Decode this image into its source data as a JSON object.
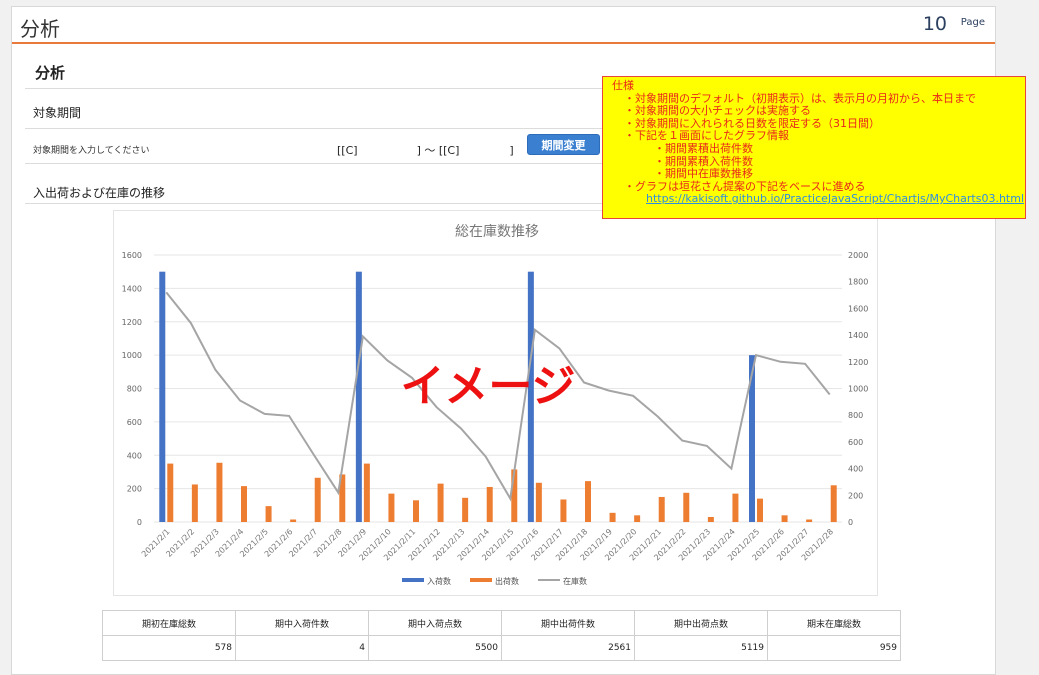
{
  "header": {
    "title": "分析",
    "page_number": "10",
    "page_label": "Page"
  },
  "section": {
    "title": "分析",
    "period_label": "対象期間",
    "period_hint": "対象期間を入力してください",
    "range_start": "[[C]",
    "range_sep": "] ～ [[C]",
    "range_end": "]",
    "change_button": "期間変更",
    "trend_label": "入出荷および在庫の推移"
  },
  "spec_note": {
    "heading": "仕様",
    "lines": [
      "・対象期間のデフォルト（初期表示）は、表示月の月初から、本日まで",
      "・対象期間の大小チェックは実施する",
      "・対象期間に入れられる日数を限定する（31日間）",
      "・下記を１画面にしたグラフ情報",
      "・期間累積出荷件数",
      "・期間累積入荷件数",
      "・期間中在庫数推移",
      "・グラフは垣花さん提案の下記をベースに進める"
    ],
    "link": "https://kakisoft.github.io/PracticeJavaScript/Chartjs/MyCharts03.html"
  },
  "chart_data": {
    "type": "bar",
    "title": "総在庫数推移",
    "overlay_text": "イメージ",
    "categories": [
      "2021/2/1",
      "2021/2/2",
      "2021/2/3",
      "2021/2/4",
      "2021/2/5",
      "2021/2/6",
      "2021/2/7",
      "2021/2/8",
      "2021/2/9",
      "2021/2/10",
      "2021/2/11",
      "2021/2/12",
      "2021/2/13",
      "2021/2/14",
      "2021/2/15",
      "2021/2/16",
      "2021/2/17",
      "2021/2/18",
      "2021/2/19",
      "2021/2/20",
      "2021/2/21",
      "2021/2/22",
      "2021/2/23",
      "2021/2/24",
      "2021/2/25",
      "2021/2/26",
      "2021/2/27",
      "2021/2/28"
    ],
    "series": [
      {
        "name": "入荷数",
        "type": "bar",
        "axis": "left",
        "color": "#4472c4",
        "values": [
          1500,
          0,
          0,
          0,
          0,
          0,
          0,
          0,
          1500,
          0,
          0,
          0,
          0,
          0,
          0,
          1500,
          0,
          0,
          0,
          0,
          0,
          0,
          0,
          0,
          1000,
          0,
          0,
          0
        ]
      },
      {
        "name": "出荷数",
        "type": "bar",
        "axis": "left",
        "color": "#ed7d31",
        "values": [
          350,
          225,
          355,
          215,
          95,
          15,
          265,
          285,
          350,
          170,
          130,
          230,
          145,
          210,
          315,
          235,
          135,
          245,
          55,
          40,
          150,
          175,
          30,
          170,
          140,
          40,
          15,
          220
        ]
      },
      {
        "name": "在庫数",
        "type": "line",
        "axis": "right",
        "color": "#a5a5a5",
        "values": [
          1720,
          1490,
          1140,
          910,
          810,
          795,
          505,
          220,
          1390,
          1210,
          1080,
          860,
          700,
          490,
          175,
          1440,
          1300,
          1045,
          985,
          945,
          790,
          610,
          570,
          400,
          1250,
          1200,
          1185,
          955
        ]
      }
    ],
    "ylim_left": [
      0,
      1600
    ],
    "yticks_left": [
      0,
      200,
      400,
      600,
      800,
      1000,
      1200,
      1400,
      1600
    ],
    "ylim_right": [
      0,
      2000
    ],
    "yticks_right": [
      0,
      200,
      400,
      600,
      800,
      1000,
      1200,
      1400,
      1600,
      1800,
      2000
    ],
    "grid": true,
    "legend": "bottom"
  },
  "summary": {
    "headers": [
      "期初在庫総数",
      "期中入荷件数",
      "期中入荷点数",
      "期中出荷件数",
      "期中出荷点数",
      "期末在庫総数"
    ],
    "values": [
      "578",
      "4",
      "5500",
      "2561",
      "5119",
      "959"
    ]
  }
}
